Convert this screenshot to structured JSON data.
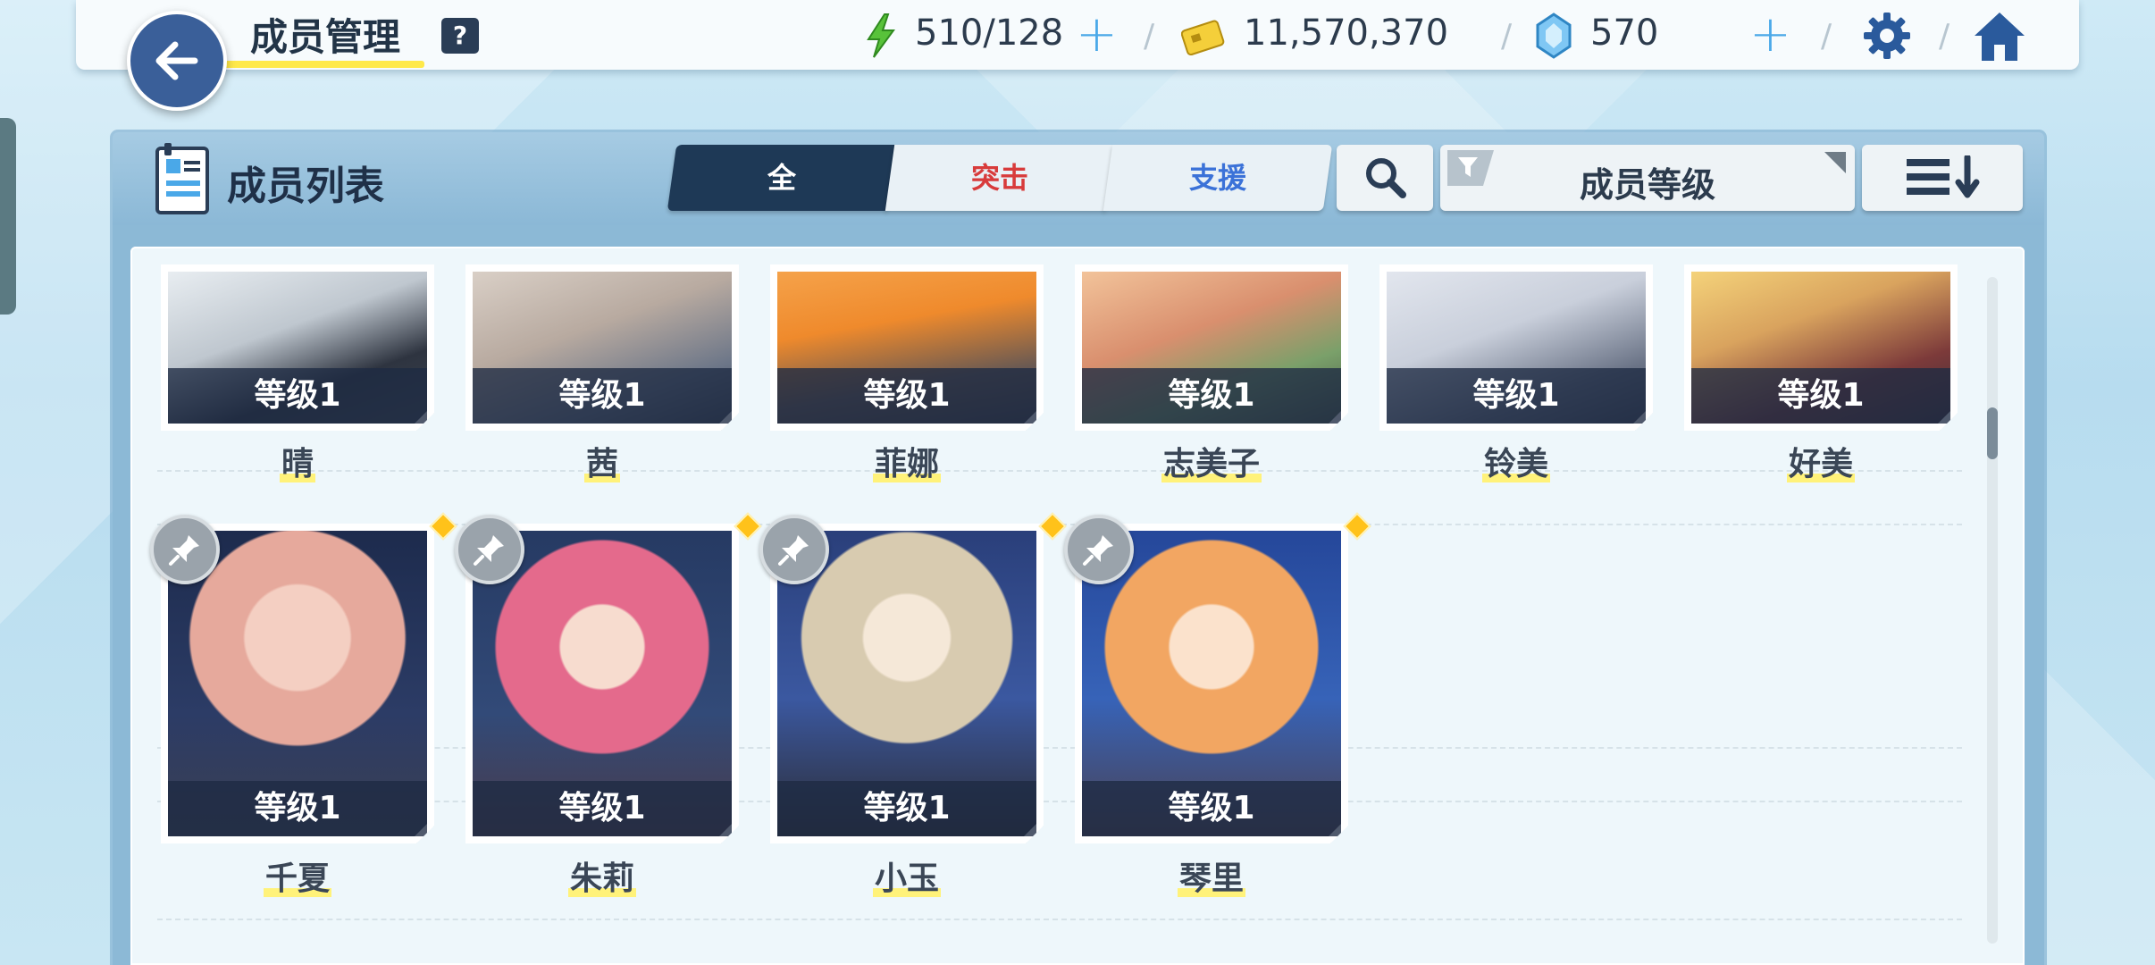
{
  "header": {
    "title": "成员管理",
    "help": "?",
    "ap": "510/128",
    "credits": "11,570,370",
    "gems": "570"
  },
  "list": {
    "title": "成员列表",
    "tabs": {
      "all": "全",
      "attack": "突击",
      "support": "支援"
    },
    "filter": "成员等级"
  },
  "members_row1": [
    {
      "level": "等级1",
      "name": "晴"
    },
    {
      "level": "等级1",
      "name": "茜"
    },
    {
      "level": "等级1",
      "name": "菲娜"
    },
    {
      "level": "等级1",
      "name": "志美子"
    },
    {
      "level": "等级1",
      "name": "铃美"
    },
    {
      "level": "等级1",
      "name": "好美"
    }
  ],
  "members_row2": [
    {
      "level": "等级1",
      "name": "千夏"
    },
    {
      "level": "等级1",
      "name": "朱莉"
    },
    {
      "level": "等级1",
      "name": "小玉"
    },
    {
      "level": "等级1",
      "name": "琴里"
    }
  ],
  "colors": {
    "accent_blue": "#3a5f99",
    "tab_active": "#1e3956",
    "attack_red": "#d83b3b",
    "support_blue": "#3b72d8",
    "plus_blue": "#4aa8e8",
    "new_marker": "#ffc21a"
  },
  "icons": [
    "back-arrow-icon",
    "help-icon",
    "ap-lightning-icon",
    "credit-card-icon",
    "gem-icon",
    "settings-gear-icon",
    "home-icon",
    "member-list-icon",
    "search-icon",
    "filter-funnel-icon",
    "sort-desc-icon",
    "pin-icon"
  ]
}
